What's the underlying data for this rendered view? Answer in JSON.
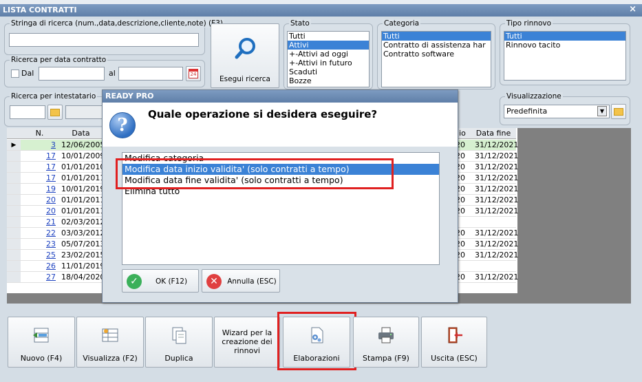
{
  "window": {
    "title": "LISTA CONTRATTI",
    "close": "×"
  },
  "search": {
    "label": "Stringa di ricerca (num.,data,descrizione,cliente,note) (F3)",
    "value": ""
  },
  "date_search": {
    "label": "Ricerca per data contratto",
    "from_label": "Dal",
    "to_label": "al",
    "calendar_text": "24"
  },
  "holder_search": {
    "label": "Ricerca per intestatario"
  },
  "search_button": {
    "label": "Esegui ricerca"
  },
  "stato": {
    "label": "Stato",
    "items": [
      "Tutti",
      "Attivi",
      "+-Attivi ad oggi",
      "+-Attivi in futuro",
      "Scaduti",
      "Bozze"
    ],
    "selected": "Attivi"
  },
  "categoria": {
    "label": "Categoria",
    "items": [
      "Tutti",
      "Contratto di assistenza har",
      "Contratto software"
    ],
    "selected": "Tutti"
  },
  "tipo_rinnovo": {
    "label": "Tipo rinnovo",
    "items": [
      "Tutti",
      "Rinnovo tacito"
    ],
    "selected": "Tutti"
  },
  "visualizzazione": {
    "label": "Visualizzazione",
    "value": "Predefinita"
  },
  "grid": {
    "headers": {
      "n": "N.",
      "data": "Data",
      "partial": "io",
      "data_fine": "Data fine"
    },
    "rows": [
      {
        "n": "3",
        "data": "12/06/2005",
        "mid": "20",
        "fine": "31/12/2021",
        "current": true
      },
      {
        "n": "17",
        "data": "10/01/2009",
        "mid": "20",
        "fine": "31/12/2021"
      },
      {
        "n": "17",
        "data": "01/01/2010",
        "mid": "20",
        "fine": "31/12/2021"
      },
      {
        "n": "17",
        "data": "01/01/2011",
        "mid": "20",
        "fine": "31/12/2021"
      },
      {
        "n": "19",
        "data": "10/01/2019",
        "mid": "20",
        "fine": "31/12/2021"
      },
      {
        "n": "20",
        "data": "01/01/2011",
        "mid": "20",
        "fine": "31/12/2021"
      },
      {
        "n": "20",
        "data": "01/01/2011",
        "mid": "20",
        "fine": "31/12/2021"
      },
      {
        "n": "21",
        "data": "02/03/2012",
        "mid": "",
        "fine": ""
      },
      {
        "n": "22",
        "data": "03/03/2012",
        "mid": "20",
        "fine": "31/12/2021"
      },
      {
        "n": "23",
        "data": "05/07/2013",
        "mid": "20",
        "fine": "31/12/2021"
      },
      {
        "n": "25",
        "data": "23/02/2015",
        "mid": "20",
        "fine": "31/12/2021"
      },
      {
        "n": "26",
        "data": "11/01/2019",
        "mid": "",
        "fine": ""
      },
      {
        "n": "27",
        "data": "18/04/2020",
        "mid": "20",
        "fine": "31/12/2021"
      }
    ]
  },
  "dialog": {
    "title": "READY PRO",
    "question": "Quale operazione si desidera eseguire?",
    "options": [
      "Modifica categoria",
      "Modifica data inizio validita' (solo contratti a tempo)",
      "Modifica data fine validita' (solo contratti a tempo)",
      "Elimina tutto"
    ],
    "selected_index": 1,
    "ok_label": "OK (F12)",
    "cancel_label": "Annulla (ESC)"
  },
  "toolbar": {
    "nuovo": "Nuovo (F4)",
    "visualizza": "Visualizza (F2)",
    "duplica": "Duplica",
    "wizard": "Wizard per la creazione dei rinnovi",
    "elaborazioni": "Elaborazioni",
    "stampa": "Stampa (F9)",
    "uscita": "Uscita (ESC)"
  },
  "colors": {
    "accent": "#3b82d6",
    "highlight": "#e02020",
    "row_current": "#d6f0d0",
    "link": "#1a3fbf"
  }
}
